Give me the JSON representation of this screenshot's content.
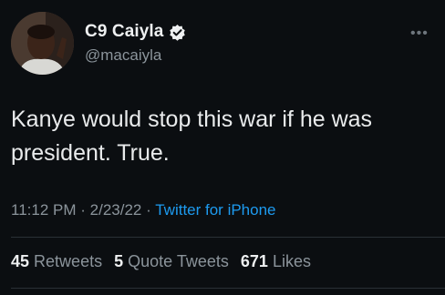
{
  "author": {
    "display_name": "C9 Caiyla",
    "handle": "@macaiyla",
    "verified": true
  },
  "tweet": {
    "text": "Kanye would stop this war if he was president. True.",
    "time": "11:12 PM",
    "date": "2/23/22",
    "separator": "·",
    "source": "Twitter for iPhone"
  },
  "stats": {
    "retweets_count": "45",
    "retweets_label": "Retweets",
    "quotes_count": "5",
    "quotes_label": "Quote Tweets",
    "likes_count": "671",
    "likes_label": "Likes"
  },
  "icons": {
    "more": "more-options-icon",
    "verified": "verified-badge-icon"
  },
  "colors": {
    "background": "#0b0e11",
    "accent": "#1d9bf0",
    "secondary_text": "#8b949b"
  }
}
